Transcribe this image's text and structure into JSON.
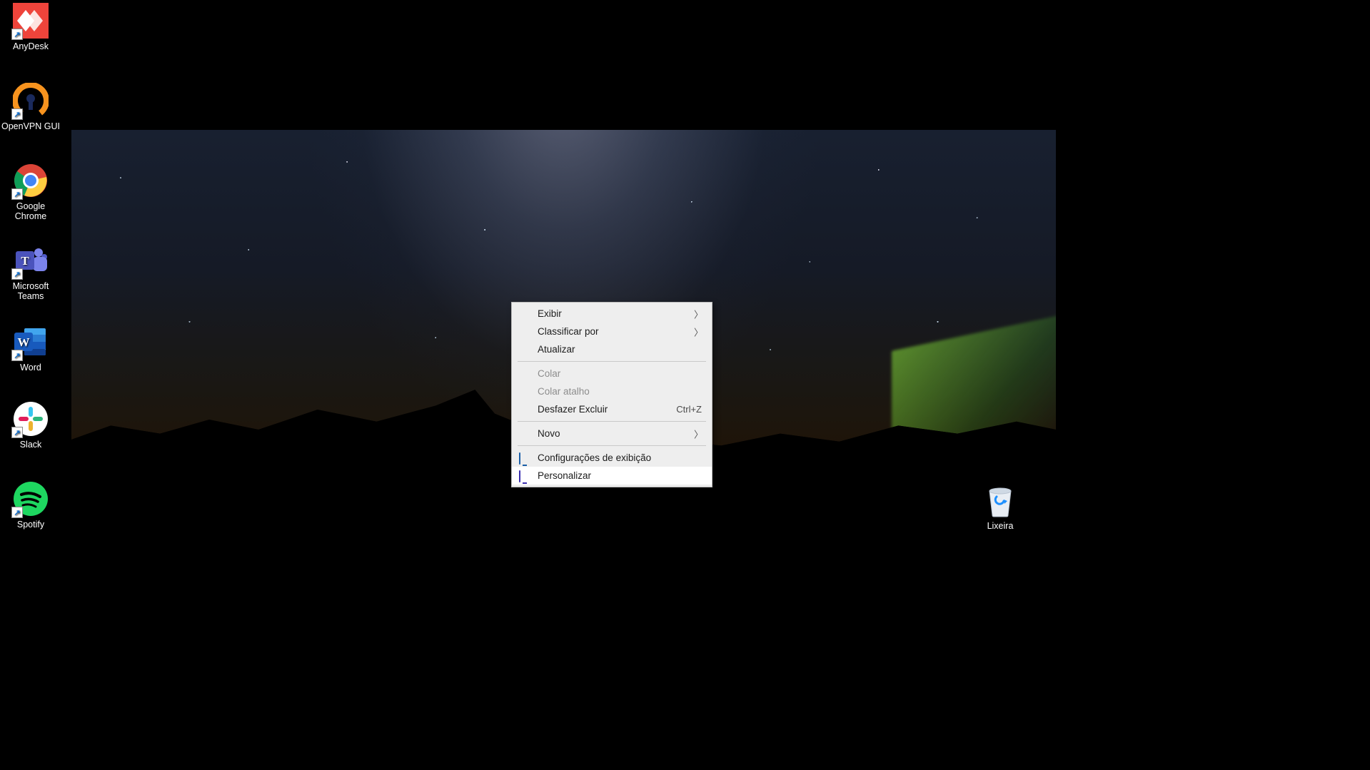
{
  "desktop_icons": [
    {
      "id": "anydesk",
      "label": "AnyDesk"
    },
    {
      "id": "openvpn",
      "label": "OpenVPN GUI"
    },
    {
      "id": "chrome",
      "label": "Google Chrome"
    },
    {
      "id": "teams",
      "label": "Microsoft Teams"
    },
    {
      "id": "word",
      "label": "Word"
    },
    {
      "id": "slack",
      "label": "Slack"
    },
    {
      "id": "spotify",
      "label": "Spotify"
    }
  ],
  "recycle_bin": {
    "label": "Lixeira"
  },
  "context_menu": {
    "view": "Exibir",
    "sort_by": "Classificar por",
    "refresh": "Atualizar",
    "paste": "Colar",
    "paste_shortcut": "Colar atalho",
    "undo_delete": "Desfazer Excluir",
    "undo_delete_key": "Ctrl+Z",
    "new": "Novo",
    "display_settings": "Configurações de exibição",
    "personalize": "Personalizar"
  }
}
